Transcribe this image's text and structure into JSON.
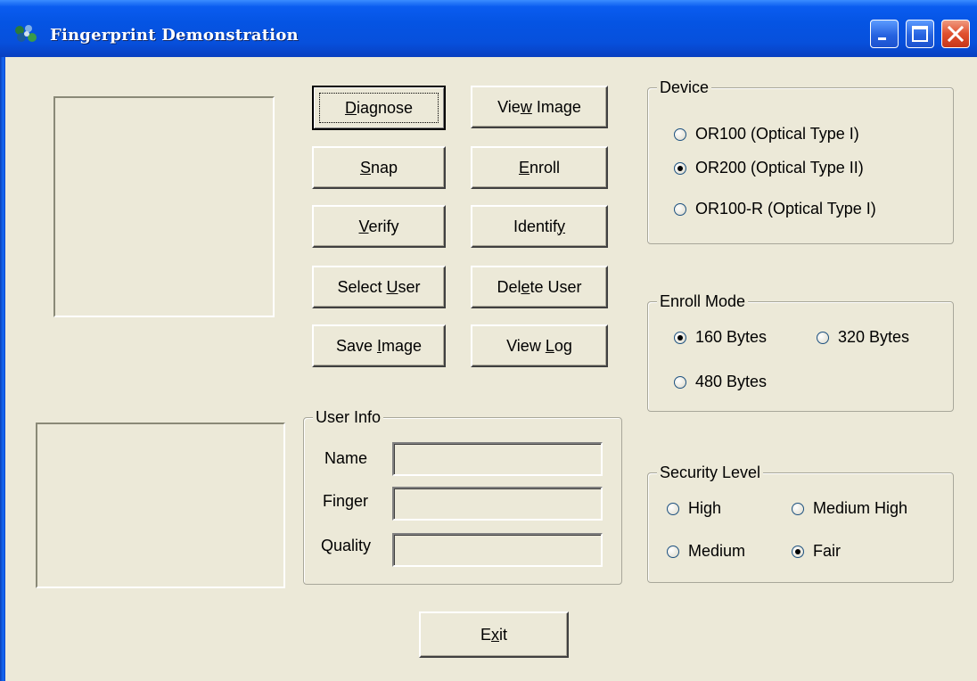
{
  "window": {
    "title": "Fingerprint Demonstration",
    "icon": "fingerprint-app-icon",
    "controls": [
      "minimize-icon",
      "maximize-icon",
      "close-icon"
    ]
  },
  "buttons": {
    "diagnose": {
      "pre": "",
      "key": "D",
      "post": "iagnose"
    },
    "view_image": {
      "pre": "Vie",
      "key": "w",
      "post": " Image"
    },
    "snap": {
      "pre": "",
      "key": "S",
      "post": "nap"
    },
    "enroll": {
      "pre": "",
      "key": "E",
      "post": "nroll"
    },
    "verify": {
      "pre": "",
      "key": "V",
      "post": "erify"
    },
    "identify": {
      "pre": "Identif",
      "key": "y",
      "post": ""
    },
    "select_user": {
      "pre": "Select ",
      "key": "U",
      "post": "ser"
    },
    "delete_user": {
      "pre": "Del",
      "key": "e",
      "post": "te User"
    },
    "save_image": {
      "pre": "Save ",
      "key": "I",
      "post": "mage"
    },
    "view_log": {
      "pre": "View ",
      "key": "L",
      "post": "og"
    },
    "exit": {
      "pre": "E",
      "key": "x",
      "post": "it"
    }
  },
  "user_info": {
    "title": "User Info",
    "name_label": "Name",
    "name_value": "",
    "finger_label": "Finger",
    "finger_value": "",
    "quality_label": "Quality",
    "quality_value": ""
  },
  "device": {
    "title": "Device",
    "options": [
      "OR100 (Optical Type I)",
      "OR200 (Optical Type II)",
      "OR100-R (Optical Type I)"
    ],
    "selected": "OR200 (Optical Type II)"
  },
  "enroll_mode": {
    "title": "Enroll Mode",
    "options": [
      "160 Bytes",
      "320 Bytes",
      "480 Bytes"
    ],
    "selected": "160 Bytes"
  },
  "security_level": {
    "title": "Security Level",
    "options": [
      "High",
      "Medium High",
      "Medium",
      "Fair"
    ],
    "selected": "Fair"
  },
  "colors": {
    "titlebar": "#0554E3",
    "face": "#ECE9D8",
    "close_button": "#E0502E"
  }
}
